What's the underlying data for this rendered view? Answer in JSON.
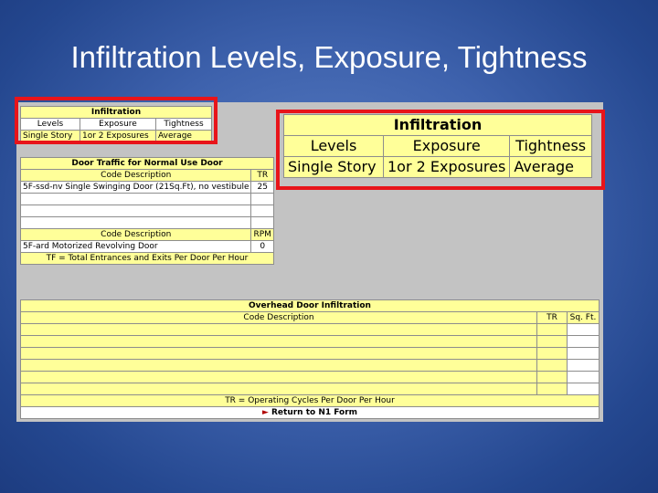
{
  "slide": {
    "title": "Infiltration Levels, Exposure, Tightness"
  },
  "infiltration": {
    "title": "Infiltration",
    "headers": [
      "Levels",
      "Exposure",
      "Tightness"
    ],
    "values": [
      "Single Story",
      "1or 2 Exposures",
      "Average"
    ]
  },
  "infiltration_zoom": {
    "title": "Infiltration",
    "headers": [
      "Levels",
      "Exposure",
      "Tightness"
    ],
    "values": [
      "Single Story",
      "1or 2 Exposures",
      "Average"
    ]
  },
  "door_traffic": {
    "title": "Door Traffic for Normal Use Door",
    "col_code": "Code Description",
    "col_tr": "TR",
    "row1_code": "5F-ssd-nv Single Swinging Door (21Sq.Ft), no vestibule",
    "row1_tr": "25",
    "col_code2": "Code Description",
    "col_rpm": "RPM",
    "row2_code": "5F-ard Motorized Revolving Door",
    "row2_rpm": "0",
    "footnote": "TF = Total Entrances and Exits Per Door Per Hour"
  },
  "overhead": {
    "title": "Overhead Door Infiltration",
    "col_code": "Code Description",
    "col_tr": "TR",
    "col_sqft": "Sq. Ft.",
    "footnote": "TR = Operating Cycles Per Door Per Hour",
    "return_link": "Return to N1 Form",
    "return_arrow": "►"
  }
}
